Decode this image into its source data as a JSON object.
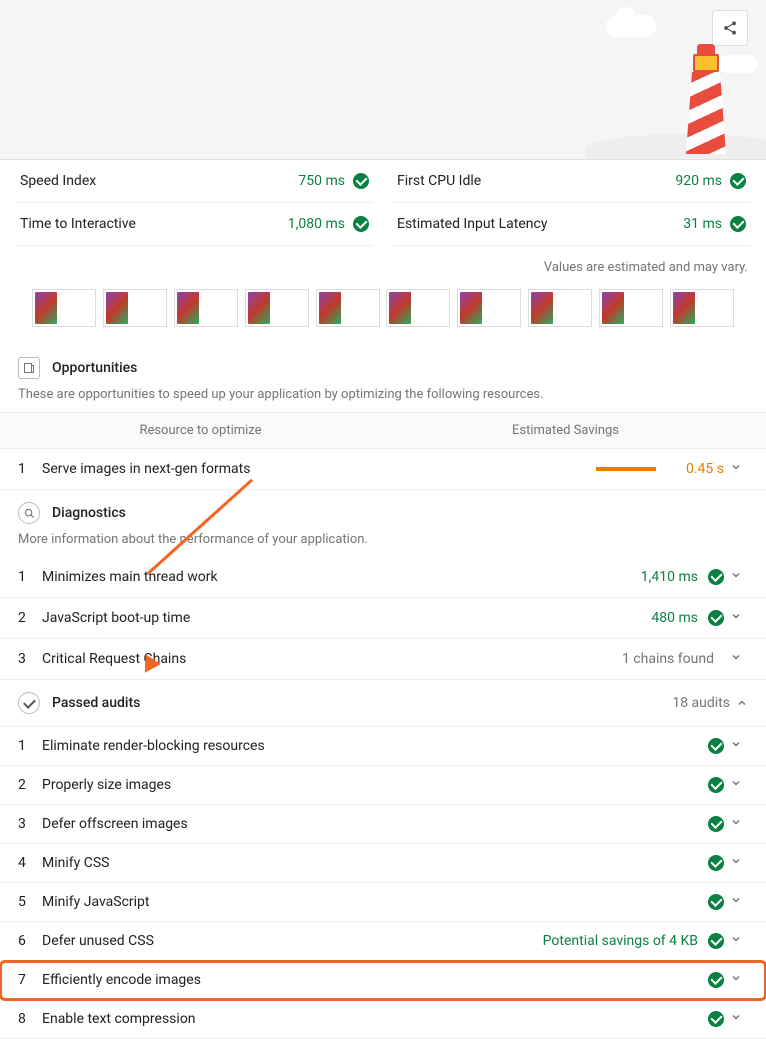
{
  "metrics": {
    "left": [
      {
        "label": "Speed Index",
        "value": "750 ms"
      },
      {
        "label": "Time to Interactive",
        "value": "1,080 ms"
      }
    ],
    "right": [
      {
        "label": "First CPU Idle",
        "value": "920 ms"
      },
      {
        "label": "Estimated Input Latency",
        "value": "31 ms"
      }
    ]
  },
  "note": "Values are estimated and may vary.",
  "opportunities": {
    "title": "Opportunities",
    "desc": "These are opportunities to speed up your application by optimizing the following resources.",
    "th_left": "Resource to optimize",
    "th_right": "Estimated Savings",
    "rows": [
      {
        "num": "1",
        "label": "Serve images in next-gen formats",
        "savings": "0.45 s"
      }
    ]
  },
  "diagnostics": {
    "title": "Diagnostics",
    "desc": "More information about the performance of your application.",
    "rows": [
      {
        "num": "1",
        "label": "Minimizes main thread work",
        "value": "1,410 ms",
        "pass": true
      },
      {
        "num": "2",
        "label": "JavaScript boot-up time",
        "value": "480 ms",
        "pass": true
      },
      {
        "num": "3",
        "label": "Critical Request Chains",
        "note": "1 chains found",
        "pass": false
      }
    ]
  },
  "passed": {
    "title": "Passed audits",
    "count": "18 audits",
    "rows": [
      {
        "num": "1",
        "label": "Eliminate render-blocking resources"
      },
      {
        "num": "2",
        "label": "Properly size images"
      },
      {
        "num": "3",
        "label": "Defer offscreen images"
      },
      {
        "num": "4",
        "label": "Minify CSS"
      },
      {
        "num": "5",
        "label": "Minify JavaScript"
      },
      {
        "num": "6",
        "label": "Defer unused CSS",
        "extra": "Potential savings of 4 KB"
      },
      {
        "num": "7",
        "label": "Efficiently encode images",
        "highlight": true
      },
      {
        "num": "8",
        "label": "Enable text compression"
      }
    ]
  }
}
